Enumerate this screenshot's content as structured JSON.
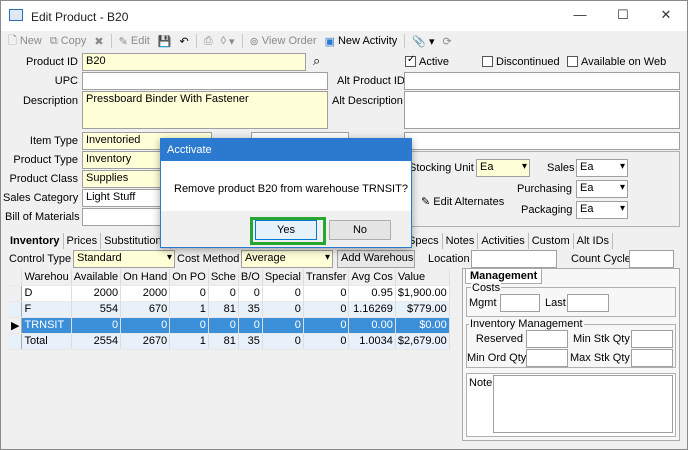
{
  "window": {
    "title": "Edit Product - B20",
    "min": "—",
    "max": "☐",
    "close": "✕"
  },
  "toolbar": {
    "new": "New",
    "copy": "Copy",
    "edit": "Edit",
    "view_order": "View Order",
    "new_activity": "New Activity"
  },
  "form": {
    "product_id_label": "Product ID",
    "product_id": "B20",
    "active_label": "Active",
    "active": true,
    "discontinued_label": "Discontinued",
    "discontinued": false,
    "available_web_label": "Available on Web",
    "available_web": false,
    "upc_label": "UPC",
    "upc": "",
    "alt_product_id_label": "Alt Product ID",
    "alt_product_id": "",
    "description_label": "Description",
    "description": "Pressboard Binder With Fastener",
    "alt_description_label": "Alt Description",
    "alt_description": "",
    "item_type_label": "Item Type",
    "item_type": "Inventoried",
    "product_type_label": "Product Type",
    "product_type": "Inventory",
    "product_class_label": "Product Class",
    "product_class": "Supplies",
    "sales_category_label": "Sales Category",
    "sales_category": "Light Stuff",
    "bill_of_materials_label": "Bill of Materials",
    "stocking_unit_label": "Stocking Unit",
    "stocking_unit": "Ea",
    "sales_label": "Sales",
    "sales": "Ea",
    "purchasing_label": "Purchasing",
    "purchasing": "Ea",
    "packaging_label": "Packaging",
    "packaging": "Ea",
    "edit_alternates": "Edit Alternates"
  },
  "tabs": [
    "Inventory",
    "Prices",
    "Substitutions"
  ],
  "tabs_right": [
    "Specs",
    "Notes",
    "Activities",
    "Custom",
    "Alt IDs"
  ],
  "inventory": {
    "control_type_label": "Control Type",
    "control_type": "Standard",
    "cost_method_label": "Cost Method",
    "cost_method": "Average",
    "add_warehouse": "Add Warehouse",
    "location_label": "Location",
    "count_cycle_label": "Count Cycle"
  },
  "grid": {
    "headers": [
      "Warehou",
      "Available",
      "On Hand",
      "On PO",
      "Sche",
      "B/O",
      "Special",
      "Transfer",
      "Avg Cos",
      "Value"
    ],
    "rows": [
      [
        "D",
        "2000",
        "2000",
        "0",
        "0",
        "0",
        "0",
        "0",
        "0.95",
        "$1,900.00"
      ],
      [
        "F",
        "554",
        "670",
        "1",
        "81",
        "35",
        "0",
        "0",
        "1.16269",
        "$779.00"
      ],
      [
        "TRNSIT",
        "0",
        "0",
        "0",
        "0",
        "0",
        "0",
        "0",
        "0.00",
        "$0.00"
      ],
      [
        "Total",
        "2554",
        "2670",
        "1",
        "81",
        "35",
        "0",
        "0",
        "1.0034",
        "$2,679.00"
      ]
    ]
  },
  "management": {
    "tab": "Management",
    "costs_legend": "Costs",
    "mgmt_label": "Mgmt",
    "last_label": "Last",
    "inv_mgmt_legend": "Inventory Management",
    "reserved_label": "Reserved",
    "min_stk_label": "Min Stk Qty",
    "min_ord_label": "Min Ord Qty",
    "max_stk_label": "Max Stk Qty",
    "note_label": "Note"
  },
  "dialog": {
    "title": "Acctivate",
    "message": "Remove product B20 from warehouse TRNSIT?",
    "yes": "Yes",
    "no": "No"
  },
  "colors": {
    "accent": "#2b7ad0",
    "highlight": "#27a632",
    "selected_row": "#3b8ed8",
    "yellow_field": "#ffffd8"
  }
}
